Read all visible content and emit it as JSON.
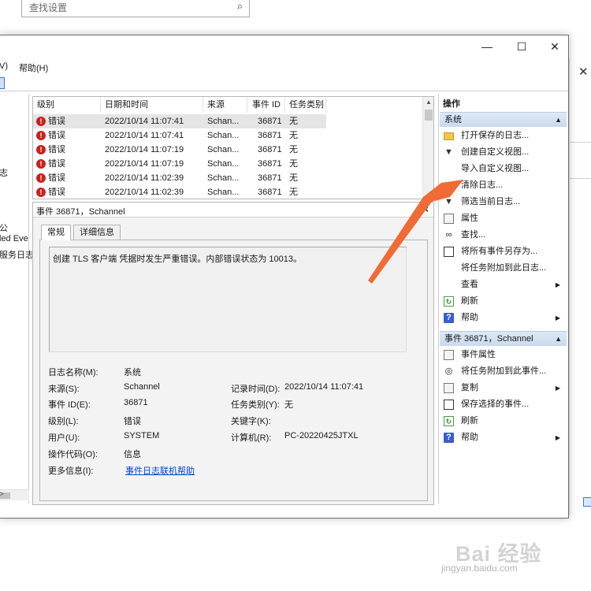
{
  "background": {
    "search_placeholder": "查找设置"
  },
  "window": {
    "controls": {
      "minimize": "—",
      "maximize": "☐",
      "close": "✕"
    },
    "menu": [
      "V)",
      "帮助(H)"
    ],
    "nav_fragments": [
      "志",
      "",
      "",
      "公",
      "led Eve",
      "服务日志"
    ]
  },
  "event_list": {
    "columns": [
      "级别",
      "日期和时间",
      "来源",
      "事件 ID",
      "任务类别"
    ],
    "rows": [
      {
        "level": "错误",
        "datetime": "2022/10/14 11:07:41",
        "source": "Schan...",
        "event_id": "36871",
        "task": "无"
      },
      {
        "level": "错误",
        "datetime": "2022/10/14 11:07:41",
        "source": "Schan...",
        "event_id": "36871",
        "task": "无"
      },
      {
        "level": "错误",
        "datetime": "2022/10/14 11:07:19",
        "source": "Schan...",
        "event_id": "36871",
        "task": "无"
      },
      {
        "level": "错误",
        "datetime": "2022/10/14 11:07:19",
        "source": "Schan...",
        "event_id": "36871",
        "task": "无"
      },
      {
        "level": "错误",
        "datetime": "2022/10/14 11:02:39",
        "source": "Schan...",
        "event_id": "36871",
        "task": "无"
      },
      {
        "level": "错误",
        "datetime": "2022/10/14 11:02:39",
        "source": "Schan...",
        "event_id": "36871",
        "task": "无"
      }
    ]
  },
  "detail": {
    "header": "事件 36871，Schannel",
    "tabs": [
      "常规",
      "详细信息"
    ],
    "description": "创建 TLS 客户端 凭据时发生严重错误。内部错误状态为 10013。",
    "fields": {
      "log_name": {
        "label": "日志名称(M):",
        "value": "系统"
      },
      "source": {
        "label": "来源(S):",
        "value": "Schannel"
      },
      "logged": {
        "label": "记录时间(D):",
        "value": "2022/10/14 11:07:41"
      },
      "event_id": {
        "label": "事件 ID(E):",
        "value": "36871"
      },
      "task_category": {
        "label": "任务类别(Y):",
        "value": "无"
      },
      "level": {
        "label": "级别(L):",
        "value": "错误"
      },
      "keywords": {
        "label": "关键字(K):",
        "value": ""
      },
      "user": {
        "label": "用户(U):",
        "value": "SYSTEM"
      },
      "computer": {
        "label": "计算机(R):",
        "value": "PC-20220425JTXL"
      },
      "opcode": {
        "label": "操作代码(O):",
        "value": "信息"
      },
      "more_info": {
        "label": "更多信息(I):",
        "value": "事件日志联机帮助"
      }
    }
  },
  "actions": {
    "title": "操作",
    "section1": {
      "header": "系统",
      "items": [
        {
          "label": "打开保存的日志...",
          "icon": "folder-icon"
        },
        {
          "label": "创建自定义视图...",
          "icon": "filter-icon"
        },
        {
          "label": "导入自定义视图...",
          "icon": ""
        },
        {
          "label": "清除日志...",
          "icon": ""
        },
        {
          "label": "筛选当前日志...",
          "icon": "filter-icon"
        },
        {
          "label": "属性",
          "icon": "properties-icon"
        },
        {
          "label": "查找...",
          "icon": "find-icon"
        },
        {
          "label": "将所有事件另存为...",
          "icon": "save-icon"
        },
        {
          "label": "将任务附加到此日志...",
          "icon": ""
        },
        {
          "label": "查看",
          "icon": ""
        },
        {
          "label": "刷新",
          "icon": "refresh-icon"
        },
        {
          "label": "帮助",
          "icon": "help-icon"
        }
      ]
    },
    "section2": {
      "header": "事件 36871，Schannel",
      "items": [
        {
          "label": "事件属性",
          "icon": "properties-icon"
        },
        {
          "label": "将任务附加到此事件...",
          "icon": "task-icon"
        },
        {
          "label": "复制",
          "icon": "copy-icon"
        },
        {
          "label": "保存选择的事件...",
          "icon": "save-icon"
        },
        {
          "label": "刷新",
          "icon": "refresh-icon"
        },
        {
          "label": "帮助",
          "icon": "help-icon"
        }
      ]
    }
  },
  "watermark": {
    "brand": "Bai 经验",
    "url": "jingyan.baidu.com"
  },
  "colors": {
    "error_red": "#c8221f",
    "annotation_orange": "#f06b35",
    "link_blue": "#0645c8",
    "section_header": "#c9d9ee"
  }
}
